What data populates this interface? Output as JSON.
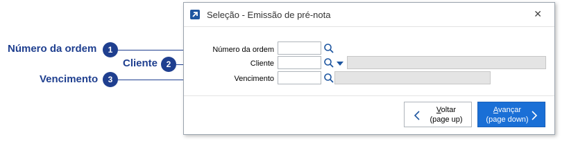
{
  "annotations": [
    {
      "title": "Número da ordem",
      "number": "1"
    },
    {
      "title": "Cliente",
      "number": "2"
    },
    {
      "title": "Vencimento",
      "number": "3"
    }
  ],
  "dialog": {
    "title": "Seleção - Emissão de pré-nota",
    "fields": [
      {
        "label": "Número da ordem",
        "value": ""
      },
      {
        "label": "Cliente",
        "value": "",
        "description": ""
      },
      {
        "label": "Vencimento",
        "value": "",
        "description": ""
      }
    ],
    "buttons": {
      "back": {
        "label": "Voltar",
        "hint": "(page up)"
      },
      "next": {
        "label": "Avançar",
        "hint": "(page down)"
      }
    }
  },
  "colors": {
    "annotation": "#1f3f8f",
    "primary_button": "#1a6fd6",
    "readonly_field": "#e4e4e4"
  },
  "icons": {
    "app": "app-shortcut-icon",
    "close": "close-icon",
    "search": "search-icon",
    "dropdown": "chevron-down-icon",
    "back": "chevron-left-icon",
    "next": "chevron-right-icon"
  }
}
